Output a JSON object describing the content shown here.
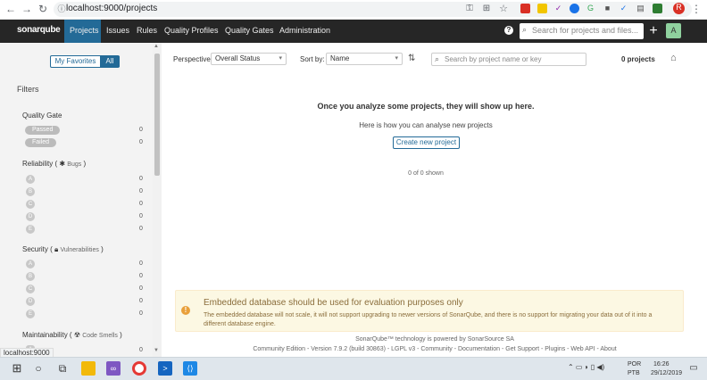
{
  "browser": {
    "url": "localhost:9000/projects",
    "status_url": "localhost:9000",
    "profile_initial": "R"
  },
  "topnav": {
    "logo": "sonarqube",
    "links": [
      "Projects",
      "Issues",
      "Rules",
      "Quality Profiles",
      "Quality Gates",
      "Administration"
    ],
    "search_placeholder": "Search for projects and files...",
    "plus": "+",
    "avatar": "A",
    "help_icon": "?"
  },
  "sidebar": {
    "toggle_my": "My Favorites",
    "toggle_all": "All",
    "filters": "Filters",
    "quality_gate": {
      "title": "Quality Gate",
      "items": [
        {
          "label": "Passed",
          "count": "0"
        },
        {
          "label": "Failed",
          "count": "0"
        }
      ]
    },
    "reliability": {
      "title": "Reliability",
      "sub": "Bugs"
    },
    "security": {
      "title": "Security",
      "sub": "Vulnerabilities"
    },
    "maintainability": {
      "title": "Maintainability",
      "sub": "Code Smells"
    },
    "ratings": [
      "A",
      "B",
      "C",
      "D",
      "E"
    ],
    "rating_count": "0"
  },
  "main": {
    "perspective_label": "Perspective:",
    "perspective_value": "Overall Status",
    "sortby_label": "Sort by:",
    "sortby_value": "Name",
    "search_placeholder": "Search by project name or key",
    "project_count": "0 projects",
    "empty_title": "Once you analyze some projects, they will show up here.",
    "empty_howto": "Here is how you can analyse new projects",
    "create_button": "Create new project",
    "shown": "0 of 0 shown"
  },
  "warning": {
    "title": "Embedded database should be used for evaluation purposes only",
    "body": "The embedded database will not scale, it will not support upgrading to newer versions of SonarQube, and there is no support for migrating your data out of it into a different database engine."
  },
  "footer": {
    "powered": "SonarQube™ technology is powered by SonarSource SA",
    "links": "Community Edition - Version 7.9.2 (build 30863) - LGPL v3 - Community - Documentation - Get Support - Plugins - Web API - About"
  },
  "taskbar": {
    "lang1": "POR",
    "lang2": "PTB",
    "time": "16:26",
    "date": "29/12/2019"
  },
  "colors": {
    "accent": "#236a97",
    "navbar": "#262626",
    "warning_bg": "#fcf8e3"
  }
}
